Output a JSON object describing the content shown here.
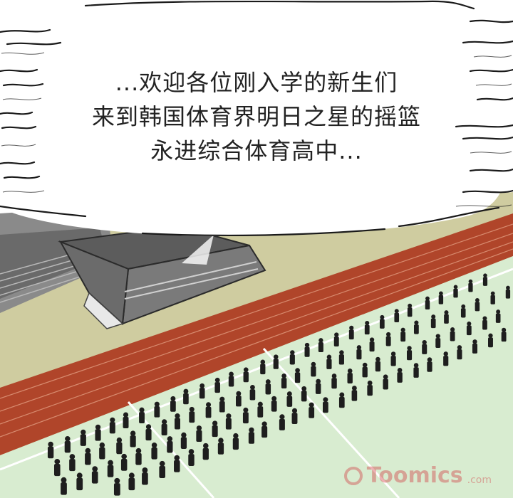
{
  "caption": {
    "lines": [
      "...欢迎各位刚入学的新生们",
      "来到韩国体育界明日之星的摇篮",
      "永进综合体育高中..."
    ]
  },
  "watermark": {
    "brand": "Toomics",
    "suffix": ".com"
  },
  "colors": {
    "track": "#b0452a",
    "field": "#d8ecd0",
    "ground": "#cfcca0",
    "building": "#6a6a6a",
    "crowd": "#1e1e1e",
    "ink": "#222222"
  }
}
